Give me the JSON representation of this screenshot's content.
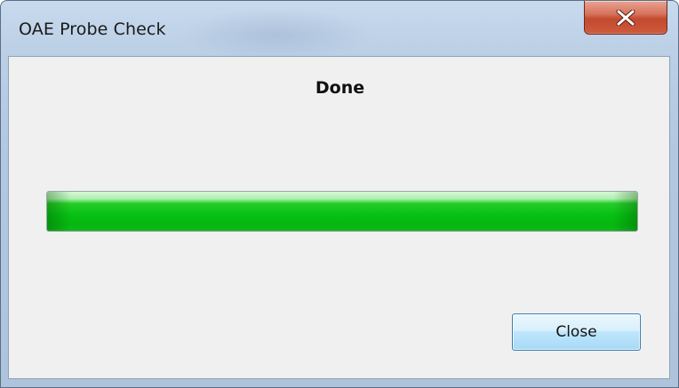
{
  "window": {
    "title": "OAE Probe Check",
    "close_icon": "close-x-icon"
  },
  "content": {
    "status": "Done",
    "progress": {
      "value_percent": 100,
      "color": "#06c012"
    },
    "close_button_label": "Close"
  }
}
